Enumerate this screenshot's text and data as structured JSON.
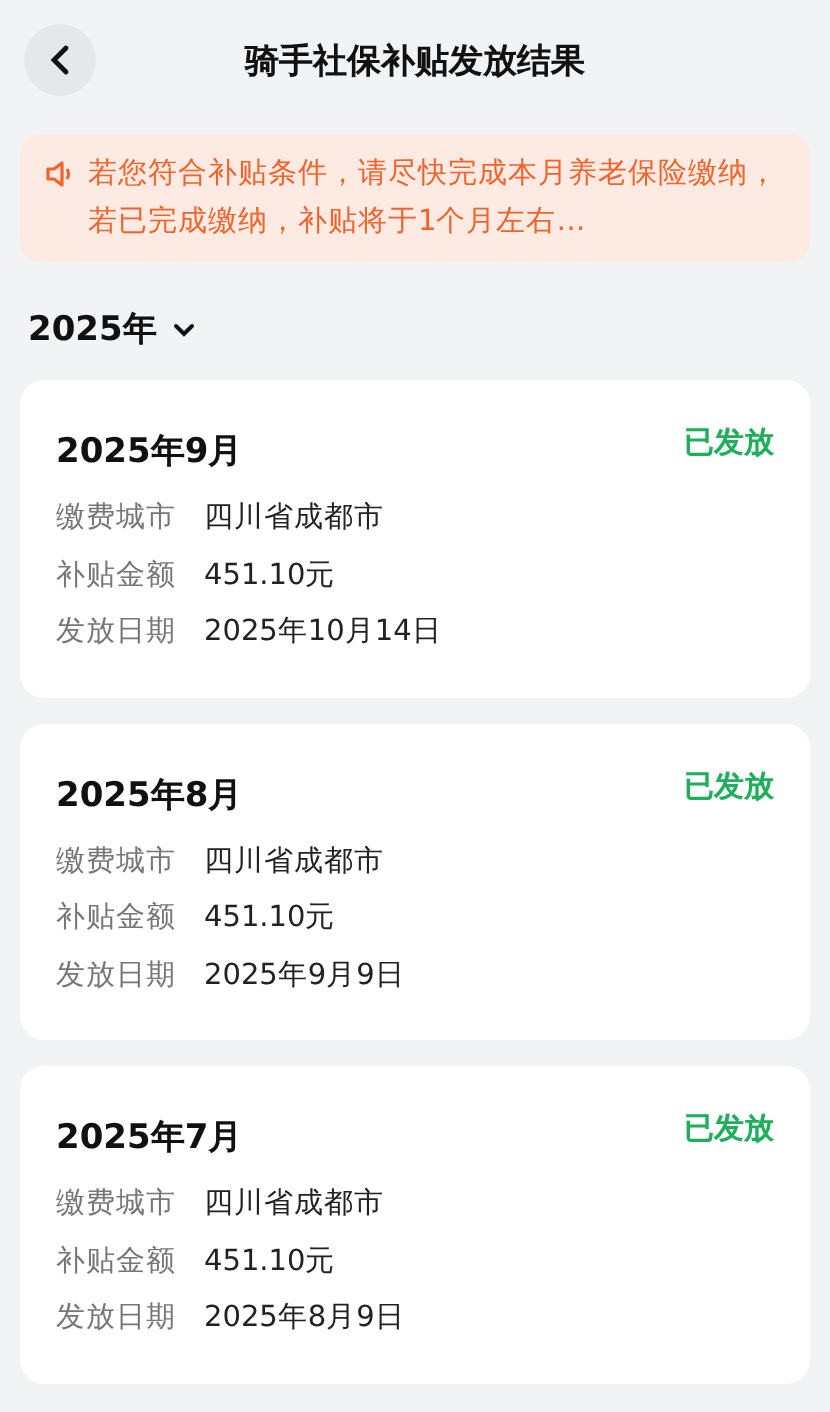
{
  "header": {
    "title": "骑手社保补贴发放结果"
  },
  "notice": {
    "text": "若您符合补贴条件，请尽快完成本月养老保险缴纳，若已完成缴纳，补贴将于1个月左右…"
  },
  "year_filter": {
    "label": "2025年",
    "expanded": false
  },
  "records": [
    {
      "month": "2025年9月",
      "status": "已发放",
      "fields": [
        {
          "label": "缴费城市",
          "value": "四川省成都市"
        },
        {
          "label": "补贴金额",
          "value": "451.10元"
        },
        {
          "label": "发放日期",
          "value": "2025年10月14日"
        }
      ]
    },
    {
      "month": "2025年8月",
      "status": "已发放",
      "fields": [
        {
          "label": "缴费城市",
          "value": "四川省成都市"
        },
        {
          "label": "补贴金额",
          "value": "451.10元"
        },
        {
          "label": "发放日期",
          "value": "2025年9月9日"
        }
      ]
    },
    {
      "month": "2025年7月",
      "status": "已发放",
      "fields": [
        {
          "label": "缴费城市",
          "value": "四川省成都市"
        },
        {
          "label": "补贴金额",
          "value": "451.10元"
        },
        {
          "label": "发放日期",
          "value": "2025年8月9日"
        }
      ]
    }
  ]
}
